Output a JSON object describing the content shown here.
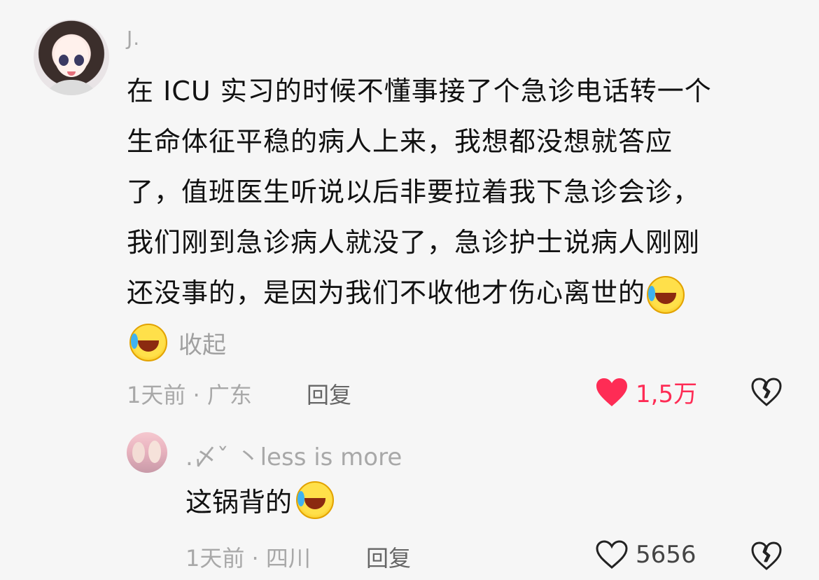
{
  "comment": {
    "username": "J.",
    "text_lines": [
      "在 ICU 实习的时候不懂事接了个急诊电话转一个",
      "生命体征平稳的病人上来，我想都没想就答应",
      "了，值班医生听说以后非要拉着我下急诊会诊，",
      "我们刚到急诊病人就没了，急诊护士说病人刚刚",
      "还没事的，是因为我们不收他才伤心离世的"
    ],
    "emoji_name": "rofl-emoji",
    "collapse_label": "收起",
    "meta": "1天前 · 广东",
    "reply_label": "回复",
    "like_count": "1,5万",
    "liked": true,
    "like_color": "#fe2c55"
  },
  "reply": {
    "username": ".〆ˇ   丶less is more",
    "text": "这锅背的",
    "meta": "1天前 · 四川",
    "reply_label": "回复",
    "like_count": "5656",
    "liked": false
  },
  "icons": {
    "heart_filled": "heart-filled-icon",
    "heart_outline": "heart-outline-icon",
    "dislike": "broken-heart-icon"
  }
}
